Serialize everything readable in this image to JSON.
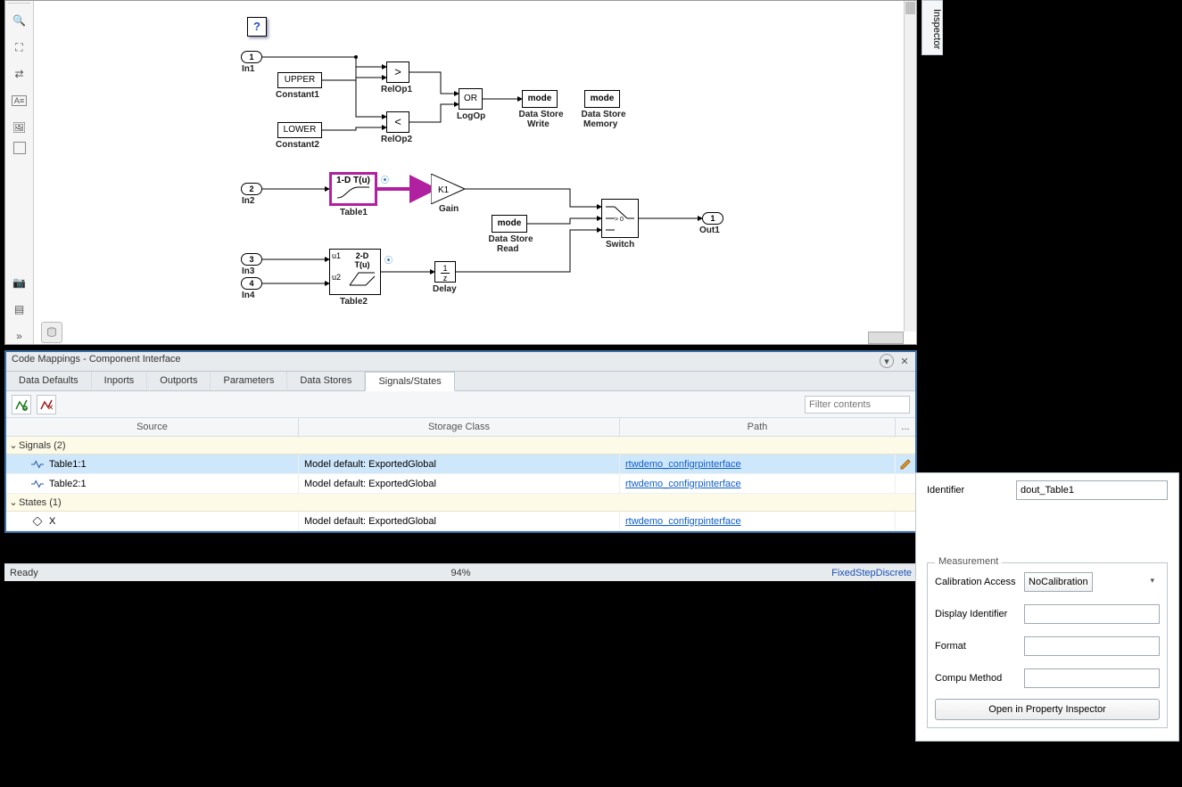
{
  "inspector_tab": "Inspector",
  "diagram": {
    "help": "?",
    "in1": {
      "num": "1",
      "label": "In1"
    },
    "in2": {
      "num": "2",
      "label": "In2"
    },
    "in3": {
      "num": "3",
      "label": "In3"
    },
    "in4": {
      "num": "4",
      "label": "In4"
    },
    "out1": {
      "num": "1",
      "label": "Out1"
    },
    "const1": {
      "text": "UPPER",
      "label": "Constant1"
    },
    "const2": {
      "text": "LOWER",
      "label": "Constant2"
    },
    "relop1": {
      "op": ">",
      "label": "RelOp1"
    },
    "relop2": {
      "op": "<",
      "label": "RelOp2"
    },
    "logop": {
      "text": "OR",
      "label": "LogOp"
    },
    "dswrite": {
      "text": "mode",
      "label1": "Data Store",
      "label2": "Write"
    },
    "dsmem": {
      "text": "mode",
      "label1": "Data Store",
      "label2": "Memory"
    },
    "dsread": {
      "text": "mode",
      "label1": "Data Store",
      "label2": "Read"
    },
    "table1": {
      "text": "1-D T(u)",
      "label": "Table1"
    },
    "table2": {
      "text": "2-D",
      "text2": "T(u)",
      "label": "Table2",
      "u1": "u1",
      "u2": "u2"
    },
    "gain": {
      "text": "K1",
      "label": "Gain"
    },
    "delay": {
      "text": "1",
      "text2": "z",
      "label": "Delay"
    },
    "switch": {
      "text": "> 0",
      "label": "Switch"
    }
  },
  "mappings": {
    "title": "Code Mappings - Component Interface",
    "tabs": [
      "Data Defaults",
      "Inports",
      "Outports",
      "Parameters",
      "Data Stores",
      "Signals/States"
    ],
    "active_tab": 5,
    "filter_placeholder": "Filter contents",
    "headers": {
      "source": "Source",
      "storage": "Storage Class",
      "path": "Path",
      "more": "..."
    },
    "signals_group": "Signals (2)",
    "states_group": "States (1)",
    "rows": [
      {
        "name": "Table1:1",
        "storage": "Model default: ExportedGlobal",
        "path": "rtwdemo_configrpinterface",
        "sel": true
      },
      {
        "name": "Table2:1",
        "storage": "Model default: ExportedGlobal",
        "path": "rtwdemo_configrpinterface",
        "sel": false
      }
    ],
    "state_rows": [
      {
        "name": "X",
        "storage": "Model default: ExportedGlobal",
        "path": "rtwdemo_configrpinterface"
      }
    ]
  },
  "status": {
    "ready": "Ready",
    "zoom": "94%",
    "solver": "FixedStepDiscrete"
  },
  "props": {
    "identifier_label": "Identifier",
    "identifier_value": "dout_Table1",
    "measurement": "Measurement",
    "cal_access_label": "Calibration Access",
    "cal_access_value": "NoCalibration",
    "disp_id_label": "Display Identifier",
    "format_label": "Format",
    "compu_label": "Compu Method",
    "open_button": "Open in Property Inspector"
  }
}
